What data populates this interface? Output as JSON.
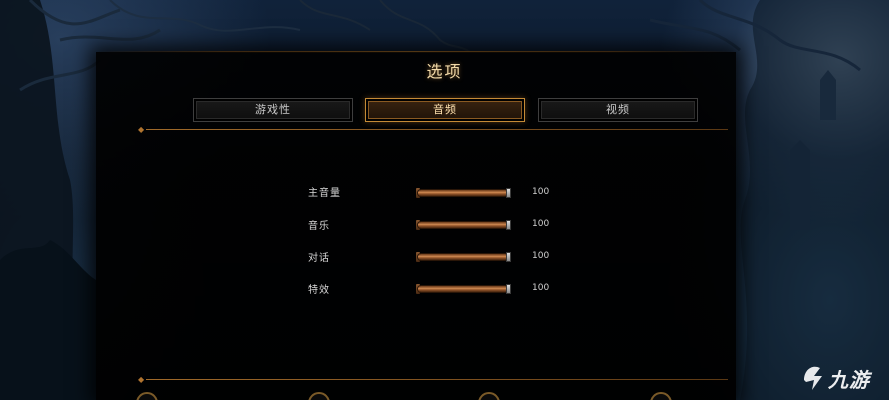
{
  "window": {
    "title": "选项"
  },
  "tabs": [
    {
      "label": "游戏性",
      "active": false
    },
    {
      "label": "音频",
      "active": true
    },
    {
      "label": "视频",
      "active": false
    }
  ],
  "audio_settings": [
    {
      "label": "主音量",
      "value": "100",
      "level_percent": 100
    },
    {
      "label": "音乐",
      "value": "100",
      "level_percent": 100
    },
    {
      "label": "对话",
      "value": "100",
      "level_percent": 100
    },
    {
      "label": "特效",
      "value": "100",
      "level_percent": 100
    }
  ],
  "watermark": {
    "text": "九游",
    "icon": "jiuyou-logo-icon"
  },
  "colors": {
    "accent": "#c48a36",
    "title": "#f2d9a8",
    "slider_fill": "#d08a52"
  }
}
